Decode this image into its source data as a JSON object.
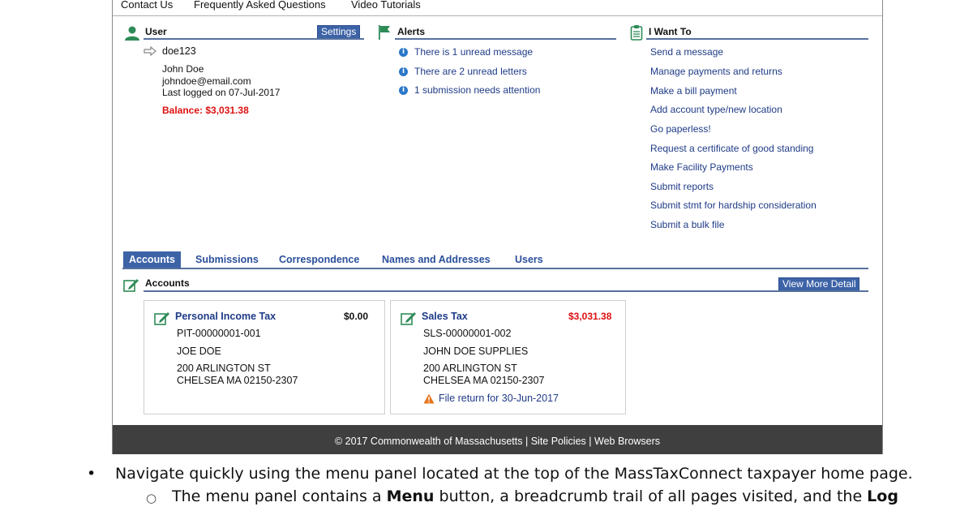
{
  "topnav": {
    "items": [
      "Contact Us",
      "Frequently Asked Questions",
      "Video Tutorials"
    ]
  },
  "user_panel": {
    "title": "User",
    "settings_label": "Settings",
    "username": "doe123",
    "name": "John Doe",
    "email": "johndoe@email.com",
    "last_logged": "Last logged on 07-Jul-2017",
    "balance": "Balance: $3,031.38"
  },
  "alerts_panel": {
    "title": "Alerts",
    "items": [
      "There is 1 unread message",
      "There are 2 unread letters",
      "1 submission needs attention"
    ]
  },
  "iwant_panel": {
    "title": "I Want To",
    "items": [
      "Send a message",
      "Manage payments and returns",
      "Make a bill payment",
      "Add account type/new location",
      "Go paperless!",
      "Request a certificate of good standing",
      "Make Facility Payments",
      "Submit reports",
      "Submit stmt for hardship consideration",
      "Submit a bulk file"
    ]
  },
  "tabs": [
    "Accounts",
    "Submissions",
    "Correspondence",
    "Names and Addresses",
    "Users"
  ],
  "accounts_section": {
    "title": "Accounts",
    "view_more_label": "View More Detail"
  },
  "accounts": [
    {
      "title": "Personal Income Tax",
      "amount": "$0.00",
      "id": "PIT-00000001-001",
      "holder": "JOE DOE",
      "address1": "200 ARLINGTON ST",
      "address2": "CHELSEA MA 02150-2307",
      "notice": ""
    },
    {
      "title": "Sales Tax",
      "amount": "$3,031.38",
      "id": "SLS-00000001-002",
      "holder": "JOHN DOE SUPPLIES",
      "address1": "200 ARLINGTON ST",
      "address2": "CHELSEA MA 02150-2307",
      "notice": "File return for 30-Jun-2017"
    }
  ],
  "footer": {
    "copyright": "© 2017 Commonwealth of Massachusetts",
    "sep": " | ",
    "link1": "Site Policies",
    "link2": "Web Browsers"
  },
  "doc": {
    "bullet1": "Navigate quickly using the menu panel located at the top of the MassTaxConnect taxpayer home page.",
    "bullet2_prefix": "The menu panel contains a ",
    "bullet2_bold1": "Menu",
    "bullet2_middle": " button, a breadcrumb trail of all pages visited, and the ",
    "bullet2_bold2": "Log"
  },
  "colors": {
    "accent_blue": "#3d63a7",
    "link_blue": "#1f3b87",
    "alert_red": "#dd1111",
    "footer_bg": "#3f3f3f",
    "icon_green": "#2e8b57"
  }
}
